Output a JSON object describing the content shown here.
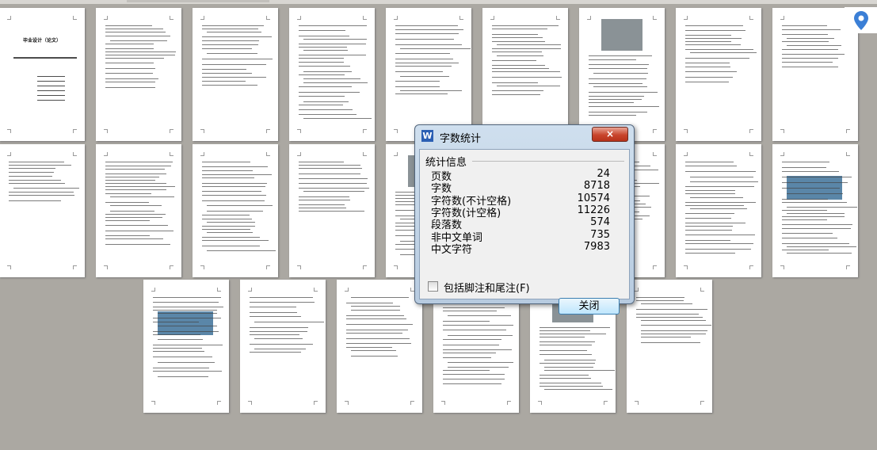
{
  "document": {
    "cover_title": "毕业设计（论文）",
    "page_count_shown": 24
  },
  "dialog": {
    "title": "字数统计",
    "logo_letter": "W",
    "close_icon": "×",
    "group_label": "统计信息",
    "stats": [
      {
        "label": "页数",
        "value": "24"
      },
      {
        "label": "字数",
        "value": "8718"
      },
      {
        "label": "字符数(不计空格)",
        "value": "10574"
      },
      {
        "label": "字符数(计空格)",
        "value": "11226"
      },
      {
        "label": "段落数",
        "value": "574"
      },
      {
        "label": "非中文单词",
        "value": "735"
      },
      {
        "label": "中文字符",
        "value": "7983"
      }
    ],
    "include_footnotes_label": "包括脚注和尾注(F)",
    "include_footnotes_checked": false,
    "close_button": "关闭"
  },
  "colors": {
    "accent": "#2b5fb3",
    "pin": "#3b7fd6",
    "background": "#aba8a2"
  }
}
